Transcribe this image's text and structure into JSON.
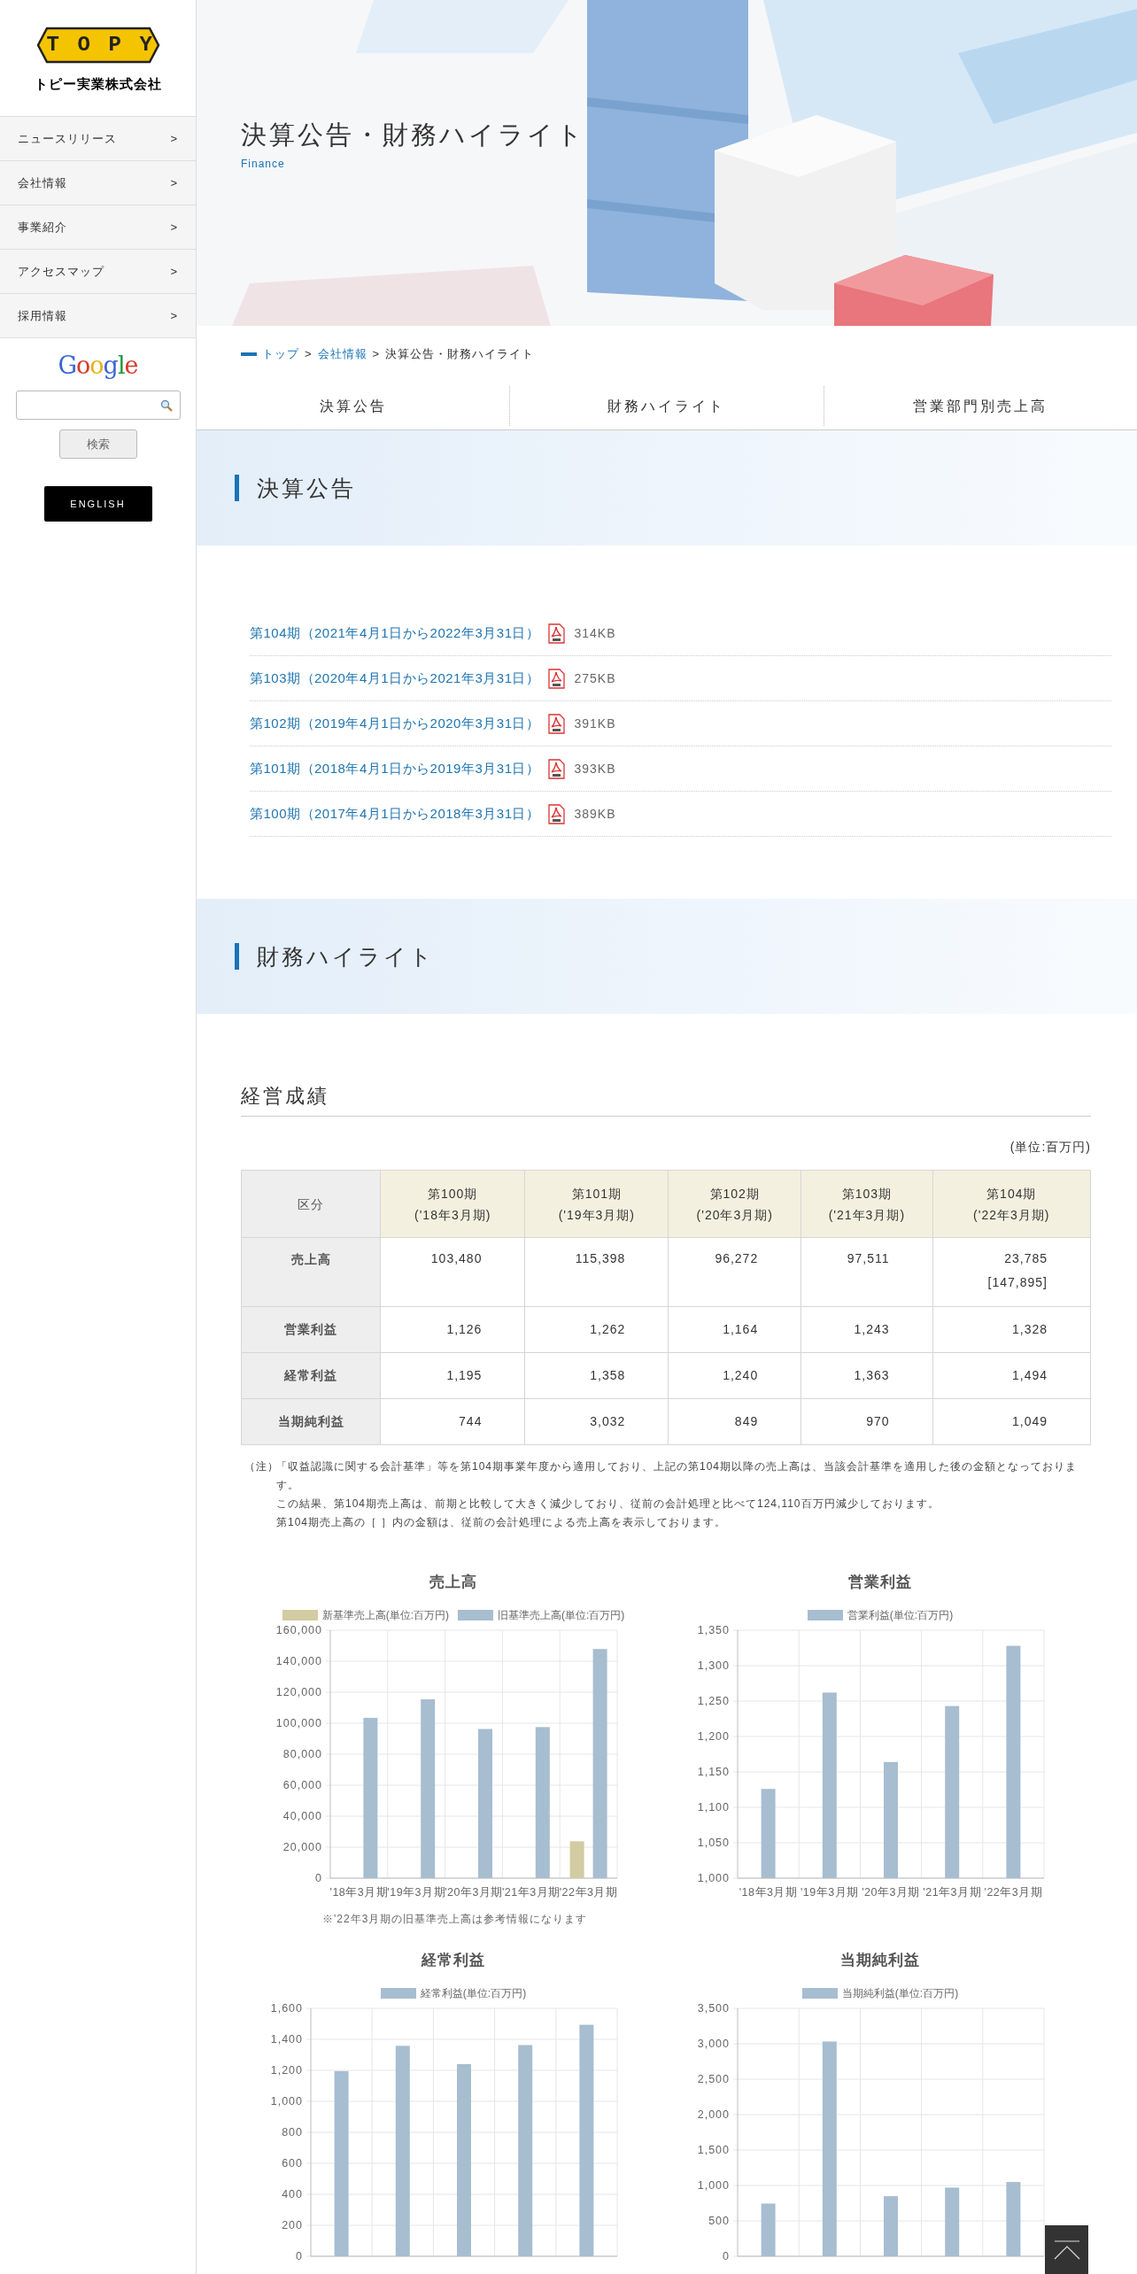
{
  "sidebar": {
    "logo": {
      "mark": "TOPY",
      "name": "トピー実業株式会社"
    },
    "menu": [
      {
        "label": "ニュースリリース",
        "arrow": ">"
      },
      {
        "label": "会社情報",
        "arrow": ">"
      },
      {
        "label": "事業紹介",
        "arrow": ">"
      },
      {
        "label": "アクセスマップ",
        "arrow": ">"
      },
      {
        "label": "採用情報",
        "arrow": ">"
      }
    ],
    "search": {
      "brand": "Google",
      "button": "検索"
    },
    "language_button": "ENGLISH"
  },
  "hero": {
    "kind": "picture",
    "title": "決算公告・財務ハイライト",
    "subtitle": "Finance"
  },
  "breadcrumb": [
    {
      "kind": "link",
      "label": "トップ"
    },
    {
      "kind": "separator",
      "label": ">"
    },
    {
      "kind": "link",
      "label": "会社情報"
    },
    {
      "kind": "separator",
      "label": ">"
    },
    {
      "kind": "current",
      "label": "決算公告・財務ハイライト"
    }
  ],
  "page_tabs": [
    "決算公告",
    "財務ハイライト",
    "営業部門別売上高"
  ],
  "announcements": {
    "heading": "決算公告",
    "documents": [
      {
        "title": "第104期（2021年4月1日から2022年3月31日）",
        "size": "314KB"
      },
      {
        "title": "第103期（2020年4月1日から2021年3月31日）",
        "size": "275KB"
      },
      {
        "title": "第102期（2019年4月1日から2020年3月31日）",
        "size": "391KB"
      },
      {
        "title": "第101期（2018年4月1日から2019年3月31日）",
        "size": "393KB"
      },
      {
        "title": "第100期（2017年4月1日から2018年3月31日）",
        "size": "389KB"
      }
    ]
  },
  "highlights": {
    "heading": "財務ハイライト",
    "subheading": "経営成績",
    "unit": "(単位:百万円)",
    "table": {
      "columns": [
        {
          "label": "区分"
        },
        {
          "label": "第100期",
          "period": "('18年3月期)"
        },
        {
          "label": "第101期",
          "period": "('19年3月期)"
        },
        {
          "label": "第102期",
          "period": "('20年3月期)"
        },
        {
          "label": "第103期",
          "period": "('21年3月期)"
        },
        {
          "label": "第104期",
          "period": "('22年3月期)"
        }
      ],
      "rows": [
        {
          "cells": [
            [
              "売上高"
            ],
            [
              "103,480"
            ],
            [
              "115,398"
            ],
            [
              "96,272"
            ],
            [
              "97,511"
            ],
            [
              "23,785",
              "[147,895]"
            ]
          ]
        },
        {
          "cells": [
            [
              "営業利益"
            ],
            [
              "1,126"
            ],
            [
              "1,262"
            ],
            [
              "1,164"
            ],
            [
              "1,243"
            ],
            [
              "1,328"
            ]
          ]
        },
        {
          "cells": [
            [
              "経常利益"
            ],
            [
              "1,195"
            ],
            [
              "1,358"
            ],
            [
              "1,240"
            ],
            [
              "1,363"
            ],
            [
              "1,494"
            ]
          ]
        },
        {
          "cells": [
            [
              "当期純利益"
            ],
            [
              "744"
            ],
            [
              "3,032"
            ],
            [
              "849"
            ],
            [
              "970"
            ],
            [
              "1,049"
            ]
          ]
        }
      ]
    },
    "notes": {
      "label": "（注）",
      "paragraphs": [
        "「収益認識に関する会計基準」等を第104期事業年度から適用しており、上記の第104期以降の売上高は、当該会計基準を適用した後の金額となっております。",
        "この結果、第104期売上高は、前期と比較して大きく減少しており、従前の会計処理と比べて124,110百万円減少しております。",
        "第104期売上高の［ ］内の金額は、従前の会計処理による売上高を表示しております。"
      ]
    },
    "charts": [
      {
        "chart_data": {
          "type": "bar",
          "title": "売上高",
          "categories": [
            "'18年3月期",
            "'19年3月期",
            "'20年3月期",
            "'21年3月期",
            "'22年3月期"
          ],
          "series": [
            {
              "name": "新基準売上高(単位:百万円)",
              "color": "#d3cba1",
              "values": [
                null,
                null,
                null,
                null,
                23785
              ]
            },
            {
              "name": "旧基準売上高(単位:百万円)",
              "color": "#a7bdd0",
              "values": [
                103480,
                115398,
                96272,
                97511,
                147895
              ]
            }
          ],
          "ylim": [
            0,
            160000
          ],
          "yticks": [
            0,
            {
              "value": 20000,
              "label": "20,000"
            },
            {
              "value": 40000,
              "label": "40,000"
            },
            {
              "value": 60000,
              "label": "60,000"
            },
            {
              "value": 80000,
              "label": "80,000"
            },
            {
              "value": 100000,
              "label": "100,000"
            },
            {
              "value": 120000,
              "label": "120,000"
            },
            {
              "value": 140000,
              "label": "140,000"
            },
            {
              "value": 160000,
              "label": "160,000"
            }
          ],
          "grid": true,
          "legend": "top"
        },
        "note": "※'22年3月期の旧基準売上高は参考情報になります"
      },
      {
        "chart_data": {
          "type": "bar",
          "title": "営業利益",
          "categories": [
            "'18年3月期",
            "'19年3月期",
            "'20年3月期",
            "'21年3月期",
            "'22年3月期"
          ],
          "series": [
            {
              "name": "営業利益(単位:百万円)",
              "color": "#a7bdd0",
              "values": [
                1126,
                1262,
                1164,
                1243,
                1328
              ]
            }
          ],
          "ylim": [
            1000,
            1350
          ],
          "yticks": [
            {
              "value": 1000,
              "label": "1,000"
            },
            {
              "value": 1050,
              "label": "1,050"
            },
            {
              "value": 1100,
              "label": "1,100"
            },
            {
              "value": 1150,
              "label": "1,150"
            },
            {
              "value": 1200,
              "label": "1,200"
            },
            {
              "value": 1250,
              "label": "1,250"
            },
            {
              "value": 1300,
              "label": "1,300"
            },
            {
              "value": 1350,
              "label": "1,350"
            }
          ],
          "grid": true,
          "legend": "top"
        }
      },
      {
        "chart_data": {
          "type": "bar",
          "title": "経常利益",
          "series": [
            {
              "name": "経常利益(単位:百万円)",
              "color": "#a7bdd0",
              "values": [
                1195,
                1358,
                1240,
                1363,
                1494
              ]
            }
          ],
          "ylim": [
            0,
            1600
          ],
          "yticks": [
            0,
            200,
            400,
            600,
            800,
            {
              "value": 1000,
              "label": "1,000"
            },
            {
              "value": 1200,
              "label": "1,200"
            },
            {
              "value": 1400,
              "label": "1,400"
            },
            {
              "value": 1600,
              "label": "1,600"
            }
          ],
          "grid": true,
          "legend": "top"
        }
      },
      {
        "chart_data": {
          "type": "bar",
          "title": "当期純利益",
          "series": [
            {
              "name": "当期純利益(単位:百万円)",
              "color": "#a7bdd0",
              "values": [
                744,
                3032,
                849,
                970,
                1049
              ]
            }
          ],
          "ylim": [
            0,
            3500
          ],
          "yticks": [
            0,
            500,
            {
              "value": 1000,
              "label": "1,000"
            },
            {
              "value": 1500,
              "label": "1,500"
            },
            {
              "value": 2000,
              "label": "2,000"
            },
            {
              "value": 2500,
              "label": "2,500"
            },
            {
              "value": 3000,
              "label": "3,000"
            },
            {
              "value": 3500,
              "label": "3,500"
            }
          ],
          "grid": true,
          "legend": "top"
        }
      }
    ]
  }
}
